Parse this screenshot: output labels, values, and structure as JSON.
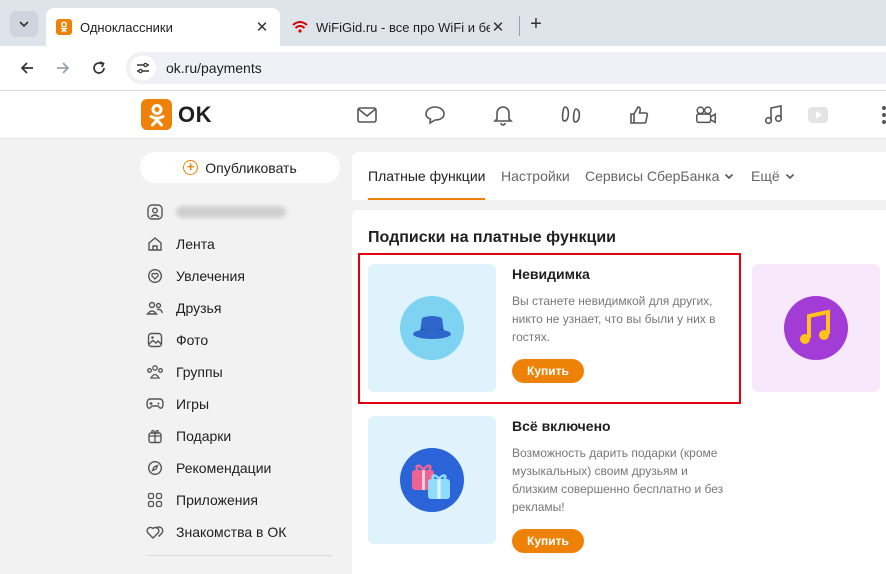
{
  "browser": {
    "tabs": [
      {
        "title": "Одноклассники",
        "active": true
      },
      {
        "title": "WiFiGid.ru - все про WiFi и бес",
        "active": false
      }
    ],
    "url": "ok.ru/payments"
  },
  "header": {
    "logo_text": "OK",
    "icons": [
      "mail-icon",
      "chat-icon",
      "bell-icon",
      "guests-icon",
      "like-icon",
      "video-icon",
      "music-icon",
      "play-icon",
      "more-icon"
    ]
  },
  "sidebar": {
    "publish_label": "Опубликовать",
    "items": [
      {
        "label": "",
        "icon": "profile-icon"
      },
      {
        "label": "Лента",
        "icon": "home-icon"
      },
      {
        "label": "Увлечения",
        "icon": "hobby-icon"
      },
      {
        "label": "Друзья",
        "icon": "friends-icon"
      },
      {
        "label": "Фото",
        "icon": "photo-icon"
      },
      {
        "label": "Группы",
        "icon": "groups-icon"
      },
      {
        "label": "Игры",
        "icon": "gamepad-icon"
      },
      {
        "label": "Подарки",
        "icon": "gift-icon"
      },
      {
        "label": "Рекомендации",
        "icon": "compass-icon"
      },
      {
        "label": "Приложения",
        "icon": "apps-icon"
      },
      {
        "label": "Знакомства в ОК",
        "icon": "dating-icon"
      }
    ]
  },
  "main": {
    "tabs": [
      {
        "label": "Платные функции",
        "active": true
      },
      {
        "label": "Настройки",
        "active": false
      },
      {
        "label": "Сервисы СберБанка",
        "active": false,
        "dropdown": true
      },
      {
        "label": "Ещё",
        "active": false,
        "dropdown": true
      }
    ],
    "section_title": "Подписки на платные функции",
    "cards": [
      {
        "title": "Невидимка",
        "description": "Вы станете невидимкой для других, никто не узнает, что вы были у них в гостях.",
        "button": "Купить",
        "icon": "invisible-hat-icon"
      },
      {
        "title": "Всё включено",
        "description": "Возможность дарить подарки (кроме музыкальных) своим друзьям и близким совершенно бесплатно и без рекламы!",
        "button": "Купить",
        "icon": "gifts-icon"
      }
    ],
    "side_card_icon": "music-note-icon"
  },
  "colors": {
    "accent": "#ee8208",
    "highlight": "#e2000f"
  }
}
